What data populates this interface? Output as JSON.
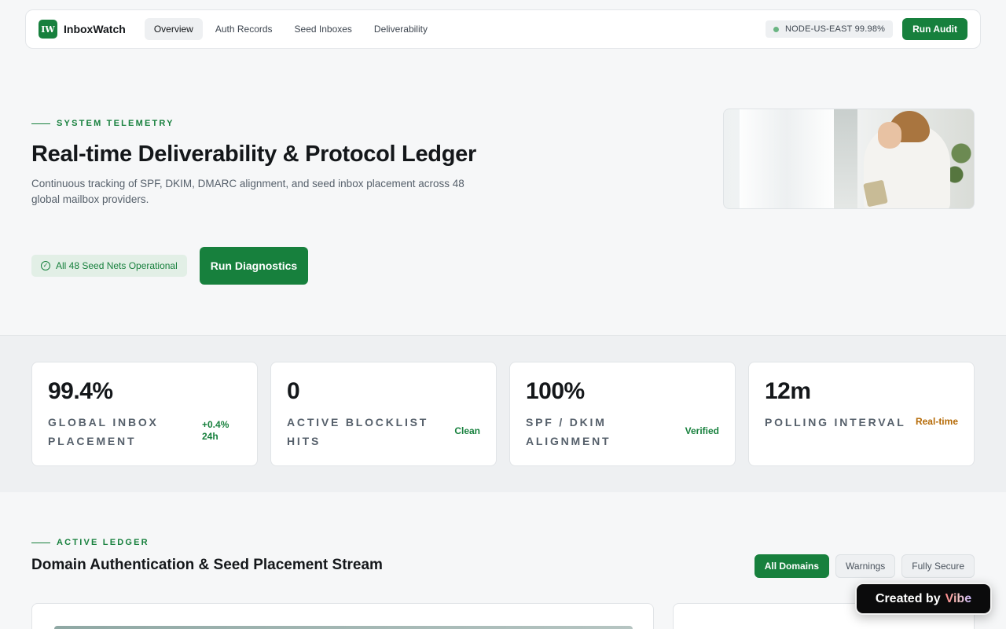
{
  "header": {
    "logo_mark": "IW",
    "brand": "InboxWatch",
    "nav": [
      {
        "label": "Overview",
        "active": true
      },
      {
        "label": "Auth Records",
        "active": false
      },
      {
        "label": "Seed Inboxes",
        "active": false
      },
      {
        "label": "Deliverability",
        "active": false
      }
    ],
    "node_status": "NODE-US-EAST 99.98%",
    "audit_button": "Run Audit"
  },
  "hero": {
    "eyebrow": "SYSTEM TELEMETRY",
    "title": "Real-time Deliverability & Protocol Ledger",
    "subtitle": "Continuous tracking of SPF, DKIM, DMARC alignment, and seed inbox placement across 48 global mailbox providers.",
    "status_pill": "All 48 Seed Nets Operational",
    "diagnostics_button": "Run Diagnostics"
  },
  "stats": [
    {
      "value": "99.4%",
      "label": "GLOBAL INBOX PLACEMENT",
      "delta": "+0.4% 24h",
      "tone": "green"
    },
    {
      "value": "0",
      "label": "ACTIVE BLOCKLIST HITS",
      "delta": "Clean",
      "tone": "green"
    },
    {
      "value": "100%",
      "label": "SPF / DKIM ALIGNMENT",
      "delta": "Verified",
      "tone": "green"
    },
    {
      "value": "12m",
      "label": "POLLING INTERVAL",
      "delta": "Real-time",
      "tone": "amber"
    }
  ],
  "ledger": {
    "eyebrow": "ACTIVE LEDGER",
    "title": "Domain Authentication & Seed Placement Stream",
    "filters": [
      {
        "label": "All Domains",
        "active": true
      },
      {
        "label": "Warnings",
        "active": false
      },
      {
        "label": "Fully Secure",
        "active": false
      }
    ]
  },
  "badge": {
    "prefix": "Created by",
    "name": "Vibe"
  },
  "colors": {
    "accent": "#17803d",
    "warning": "#b56a06",
    "background": "#f6f7f8"
  }
}
